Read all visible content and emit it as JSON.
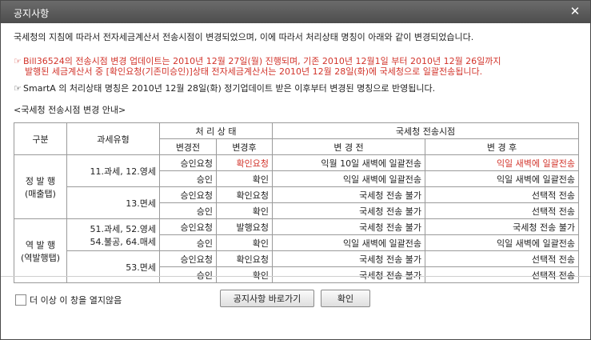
{
  "window": {
    "title": "공지사항"
  },
  "notice": {
    "line1": "국세청의 지침에 따라서 전자세금계산서 전송시점이 변경되었으며, 이에 따라서 처리상태 명칭이 아래와 같이 변경되었습니다.",
    "marker": "☞",
    "line2a": "Bill36524의 전송시점 변경 업데이트는 2010년 12월 27일(월) 진행되며, 기존 2010년 12월1일 부터 2010년 12월 26일까지",
    "line2b": "발행된 세금계산서 중 [확인요청(기존미승인)]상태 전자세금계산서는  2010년 12월 28일(화)에 국세청으로 일괄전송됩니다.",
    "line3": "SmartA 의 처리상태 명칭은 2010년 12월 28일(화) 정기업데이트 받은 이후부터 변경된 명칭으로 반영됩니다.",
    "section_title": "<국세청 전송시점 변경 안내>"
  },
  "table": {
    "headers": {
      "gubun": "구분",
      "tax_type": "과세유형",
      "status": "처 리 상 태",
      "nts": "국세청 전송시점",
      "before": "변경전",
      "after": "변경후",
      "nts_before": "변 경 전",
      "nts_after": "변 경 후"
    },
    "groups": [
      {
        "label1": "정 발 행",
        "label2": "(매출탭)",
        "subgroups": [
          {
            "tax_type": "11.과세, 12.영세",
            "rows": [
              {
                "before": "승인요청",
                "after": "확인요청",
                "nts_before": "익월 10일 새벽에 일괄전송",
                "nts_after": "익일 새벽에 일괄전송",
                "red": true
              },
              {
                "before": "승인",
                "after": "확인",
                "nts_before": "익일 새벽에 일괄전송",
                "nts_after": "익일 새벽에 일괄전송",
                "red": false
              }
            ]
          },
          {
            "tax_type": "13.면세",
            "rows": [
              {
                "before": "승인요청",
                "after": "확인요청",
                "nts_before": "국세청 전송 불가",
                "nts_after": "선택적 전송",
                "red": false
              },
              {
                "before": "승인",
                "after": "확인",
                "nts_before": "국세청 전송 불가",
                "nts_after": "선택적 전송",
                "red": false
              }
            ]
          }
        ]
      },
      {
        "label1": "역 발 행",
        "label2": "(역발행탭)",
        "subgroups": [
          {
            "tax_type": "51.과세, 52.영세",
            "tax_type2": "54.불공, 64.매세",
            "rows": [
              {
                "before": "승인요청",
                "after": "발행요청",
                "nts_before": "국세청 전송 불가",
                "nts_after": "국세청 전송 불가",
                "red": false
              },
              {
                "before": "승인",
                "after": "확인",
                "nts_before": "익일 새벽에 일괄전송",
                "nts_after": "익일 새벽에 일괄전송",
                "red": false
              }
            ]
          },
          {
            "tax_type": "53.면세",
            "rows": [
              {
                "before": "승인요청",
                "after": "확인요청",
                "nts_before": "국세청 전송 불가",
                "nts_after": "선택적 전송",
                "red": false
              },
              {
                "before": "승인",
                "after": "확인",
                "nts_before": "국세청 전송 불가",
                "nts_after": "선택적 전송",
                "red": false
              }
            ]
          }
        ]
      }
    ]
  },
  "footer": {
    "checkbox_label": "더 이상 이 창을 열지않음",
    "notice_button": "공지사항 바로가기",
    "ok_button": "확인"
  },
  "colors": {
    "accent_red": "#d2342b",
    "titlebar": "#5a5a5a"
  },
  "icons": {
    "close": "close-icon",
    "marker": "hand-pointer-icon"
  }
}
